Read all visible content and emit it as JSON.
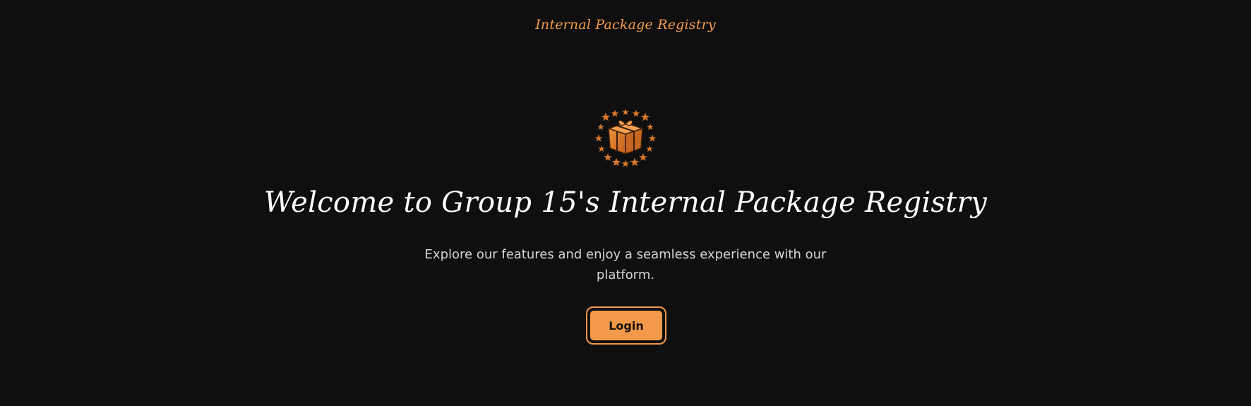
{
  "header": {
    "title": "Internal Package Registry"
  },
  "hero": {
    "logo_icon": "gift-box-with-stars-icon",
    "title": "Welcome to Group 15's Internal Package Registry",
    "subtitle": "Explore our features and enjoy a seamless experience with our platform.",
    "login_label": "Login"
  },
  "colors": {
    "background": "#0f0f0f",
    "accent": "#f29a4a",
    "title_text": "#ffffff",
    "body_text": "#d6d6d6"
  }
}
